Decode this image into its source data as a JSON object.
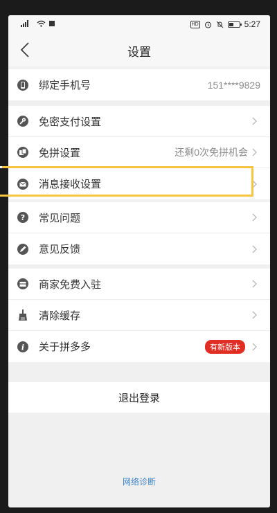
{
  "status_bar": {
    "time": "5:27",
    "hd": "HD"
  },
  "nav": {
    "title": "设置"
  },
  "rows": {
    "phone": {
      "label": "绑定手机号",
      "value": "151****9829"
    },
    "pay": {
      "label": "免密支付设置"
    },
    "pin": {
      "label": "免拼设置",
      "value": "还剩0次免拼机会"
    },
    "msg": {
      "label": "消息接收设置"
    },
    "faq": {
      "label": "常见问题"
    },
    "feedback": {
      "label": "意见反馈"
    },
    "merchant": {
      "label": "商家免费入驻"
    },
    "cache": {
      "label": "清除缓存"
    },
    "about": {
      "label": "关于拼多多",
      "badge": "有新版本"
    }
  },
  "logout": "退出登录",
  "network_diagnose": "网络诊断",
  "colors": {
    "accent_highlight": "#f7c542",
    "badge_red": "#e02e24",
    "link_blue": "#3b82c4"
  }
}
